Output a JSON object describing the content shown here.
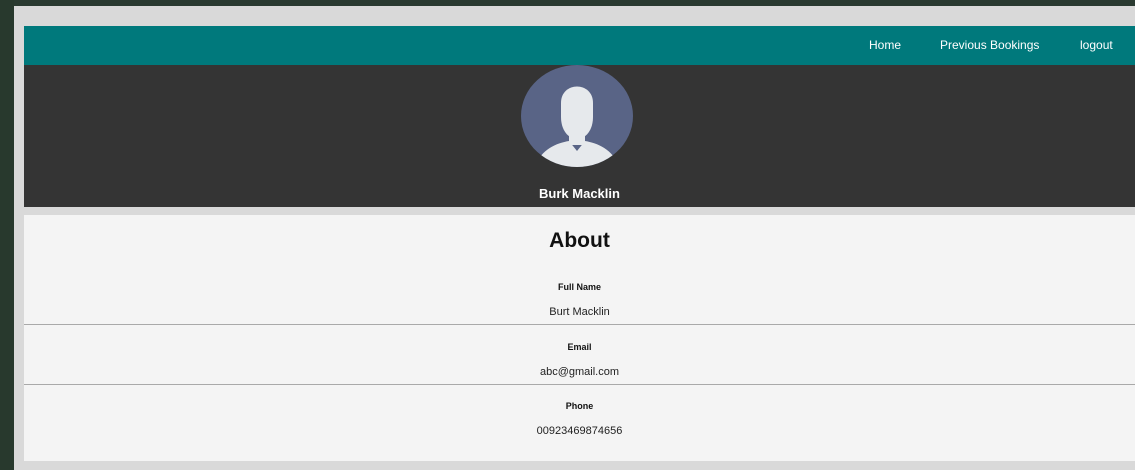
{
  "nav": {
    "home": "Home",
    "previous_bookings": "Previous Bookings",
    "logout": "logout"
  },
  "profile": {
    "avatar_icon": "user-avatar-icon",
    "name": "Burk Macklin"
  },
  "about": {
    "title": "About",
    "fields": [
      {
        "label": "Full Name",
        "value": "Burt Macklin"
      },
      {
        "label": "Email",
        "value": "abc@gmail.com"
      },
      {
        "label": "Phone",
        "value": "00923469874656"
      }
    ]
  },
  "colors": {
    "navbar": "#00797c",
    "header": "#343434",
    "avatar_bg": "#596486",
    "panel": "#f4f4f4"
  }
}
